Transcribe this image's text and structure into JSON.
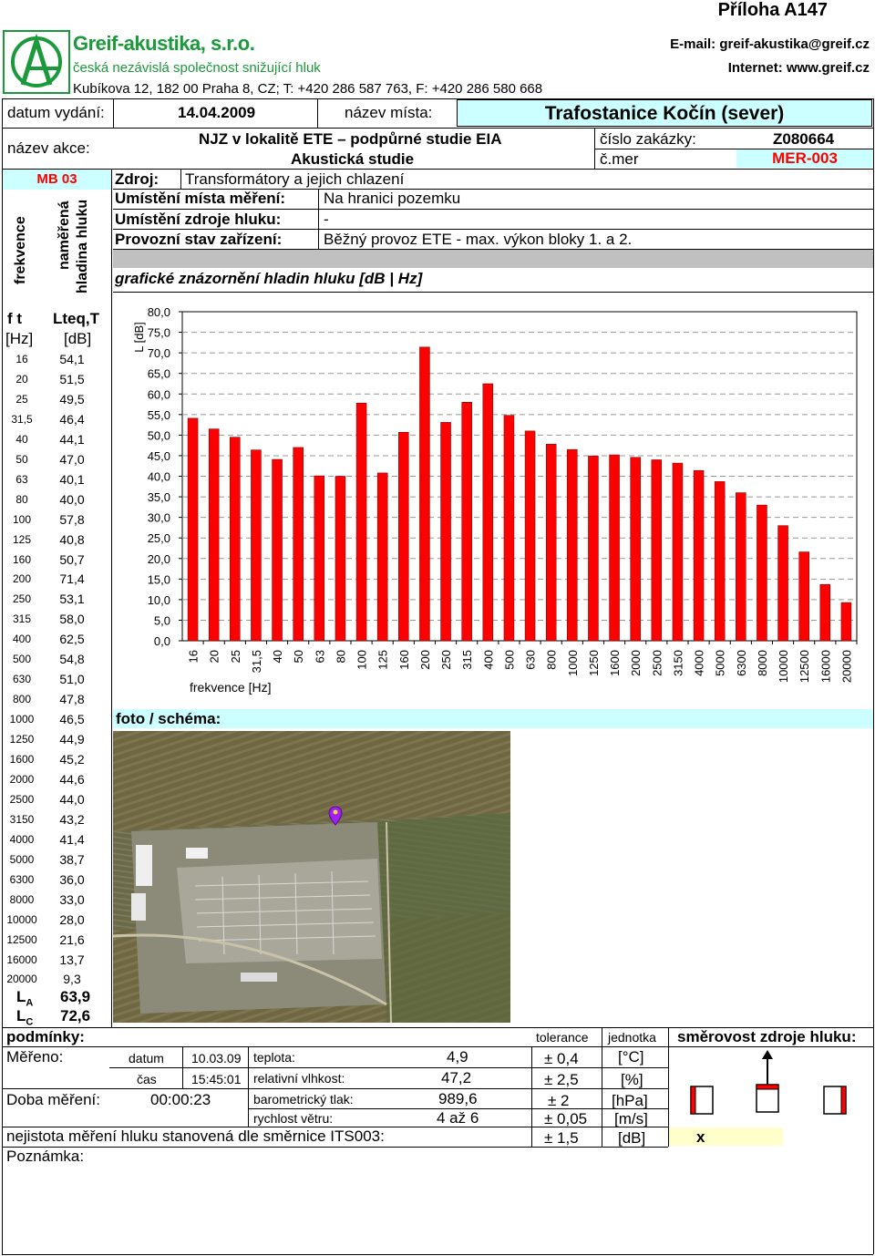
{
  "header": {
    "appendix": "Příloha A147",
    "company": "Greif-akustika, s.r.o.",
    "tagline": "česká nezávislá společnost snižující hluk",
    "address": "Kubíkova 12, 182 00 Praha 8, CZ; T: +420 286 587 763, F: +420 286 580 668",
    "email": "E-mail: greif-akustika@greif.cz",
    "internet": "Internet: www.greif.cz",
    "logo_color": "#1a9a3a"
  },
  "info": {
    "issue_date_label": "datum vydání:",
    "issue_date": "14.04.2009",
    "place_label": "název místa:",
    "place": "Trafostanice Kočín (sever)",
    "action_label": "název akce:",
    "action_line1": "NJZ v lokalitě ETE – podpůrné studie EIA",
    "action_line2": "Akustická studie",
    "order_label": "číslo zakázky:",
    "order": "Z080664",
    "mer_label": "č.mer",
    "mer": "MER-003",
    "mb": "MB 03",
    "source_label": "Zdroj:",
    "source": "Transformátory a jejich chlazení",
    "loc_label": "Umístění místa měření:",
    "loc": "Na hranici pozemku",
    "srcloc_label": "Umístění zdroje hluku:",
    "srcloc": "-",
    "mode_label": "Provozní stav zařízení:",
    "mode": "Běžný provoz ETE - max. výkon bloky 1. a 2.",
    "graph_label": "grafické znázornění hladin hluku [dB | Hz]",
    "photo_label": "foto / schéma:"
  },
  "table": {
    "side_label_freq": "frekvence",
    "side_label_level1": "naměřená",
    "side_label_level2": "hladina hluku",
    "col_f": "f t",
    "col_l": "Lteq,T",
    "unit_f": "[Hz]",
    "unit_l": "[dB]",
    "rows": [
      {
        "f": "16",
        "v": "54,1"
      },
      {
        "f": "20",
        "v": "51,5"
      },
      {
        "f": "25",
        "v": "49,5"
      },
      {
        "f": "31,5",
        "v": "46,4"
      },
      {
        "f": "40",
        "v": "44,1"
      },
      {
        "f": "50",
        "v": "47,0"
      },
      {
        "f": "63",
        "v": "40,1"
      },
      {
        "f": "80",
        "v": "40,0"
      },
      {
        "f": "100",
        "v": "57,8"
      },
      {
        "f": "125",
        "v": "40,8"
      },
      {
        "f": "160",
        "v": "50,7"
      },
      {
        "f": "200",
        "v": "71,4"
      },
      {
        "f": "250",
        "v": "53,1"
      },
      {
        "f": "315",
        "v": "58,0"
      },
      {
        "f": "400",
        "v": "62,5"
      },
      {
        "f": "500",
        "v": "54,8"
      },
      {
        "f": "630",
        "v": "51,0"
      },
      {
        "f": "800",
        "v": "47,8"
      },
      {
        "f": "1000",
        "v": "46,5"
      },
      {
        "f": "1250",
        "v": "44,9"
      },
      {
        "f": "1600",
        "v": "45,2"
      },
      {
        "f": "2000",
        "v": "44,6"
      },
      {
        "f": "2500",
        "v": "44,0"
      },
      {
        "f": "3150",
        "v": "43,2"
      },
      {
        "f": "4000",
        "v": "41,4"
      },
      {
        "f": "5000",
        "v": "38,7"
      },
      {
        "f": "6300",
        "v": "36,0"
      },
      {
        "f": "8000",
        "v": "33,0"
      },
      {
        "f": "10000",
        "v": "28,0"
      },
      {
        "f": "12500",
        "v": "21,6"
      },
      {
        "f": "16000",
        "v": "13,7"
      },
      {
        "f": "20000",
        "v": "9,3"
      }
    ],
    "la_label": "L",
    "la_sub": "A",
    "la": "63,9",
    "lc_label": "L",
    "lc_sub": "C",
    "lc": "72,6"
  },
  "conditions": {
    "title": "podmínky:",
    "tolerance_label": "tolerance",
    "unit_label": "jednotka",
    "direction_label": "směrovost zdroje hluku:",
    "measured_label": "Měřeno:",
    "date_label": "datum",
    "date": "10.03.09",
    "time_label": "čas",
    "time": "15:45:01",
    "duration_label": "Doba měření:",
    "duration": "00:00:23",
    "temp_label": "teplota:",
    "temp": "4,9",
    "temp_tol": "± 0,4",
    "temp_unit": "[°C]",
    "hum_label": "relativní vlhkost:",
    "hum": "47,2",
    "hum_tol": "± 2,5",
    "hum_unit": "[%]",
    "press_label": "barometrický tlak:",
    "press": "989,6",
    "press_tol": "± 2",
    "press_unit": "[hPa]",
    "wind_label": "rychlost větru:",
    "wind": "4 až 6",
    "wind_tol": "± 0,05",
    "wind_unit": "[m/s]",
    "unc_label": "nejistota měření hluku stanovená dle směrnice ITS003:",
    "unc_tol": "± 1,5",
    "unc_unit": "[dB]",
    "unc_mark": "x",
    "note_label": "Poznámka:"
  },
  "chart_data": {
    "type": "bar",
    "categories": [
      "16",
      "20",
      "25",
      "31,5",
      "40",
      "50",
      "63",
      "80",
      "100",
      "125",
      "160",
      "200",
      "250",
      "315",
      "400",
      "500",
      "630",
      "800",
      "1000",
      "1250",
      "1600",
      "2000",
      "2500",
      "3150",
      "4000",
      "5000",
      "6300",
      "8000",
      "10000",
      "12500",
      "16000",
      "20000"
    ],
    "values": [
      54.1,
      51.5,
      49.5,
      46.4,
      44.1,
      47.0,
      40.1,
      40.0,
      57.8,
      40.8,
      50.7,
      71.4,
      53.1,
      58.0,
      62.5,
      54.8,
      51.0,
      47.8,
      46.5,
      44.9,
      45.2,
      44.6,
      44.0,
      43.2,
      41.4,
      38.7,
      36.0,
      33.0,
      28.0,
      21.6,
      13.7,
      9.3
    ],
    "ylabel": "L [dB]",
    "xlabel": "frekvence [Hz]",
    "ylim": [
      0,
      80
    ],
    "yticks": [
      "0,0",
      "5,0",
      "10,0",
      "15,0",
      "20,0",
      "25,0",
      "30,0",
      "35,0",
      "40,0",
      "45,0",
      "50,0",
      "55,0",
      "60,0",
      "65,0",
      "70,0",
      "75,0",
      "80,0"
    ],
    "grid": true,
    "bar_color": "#ff0000"
  }
}
